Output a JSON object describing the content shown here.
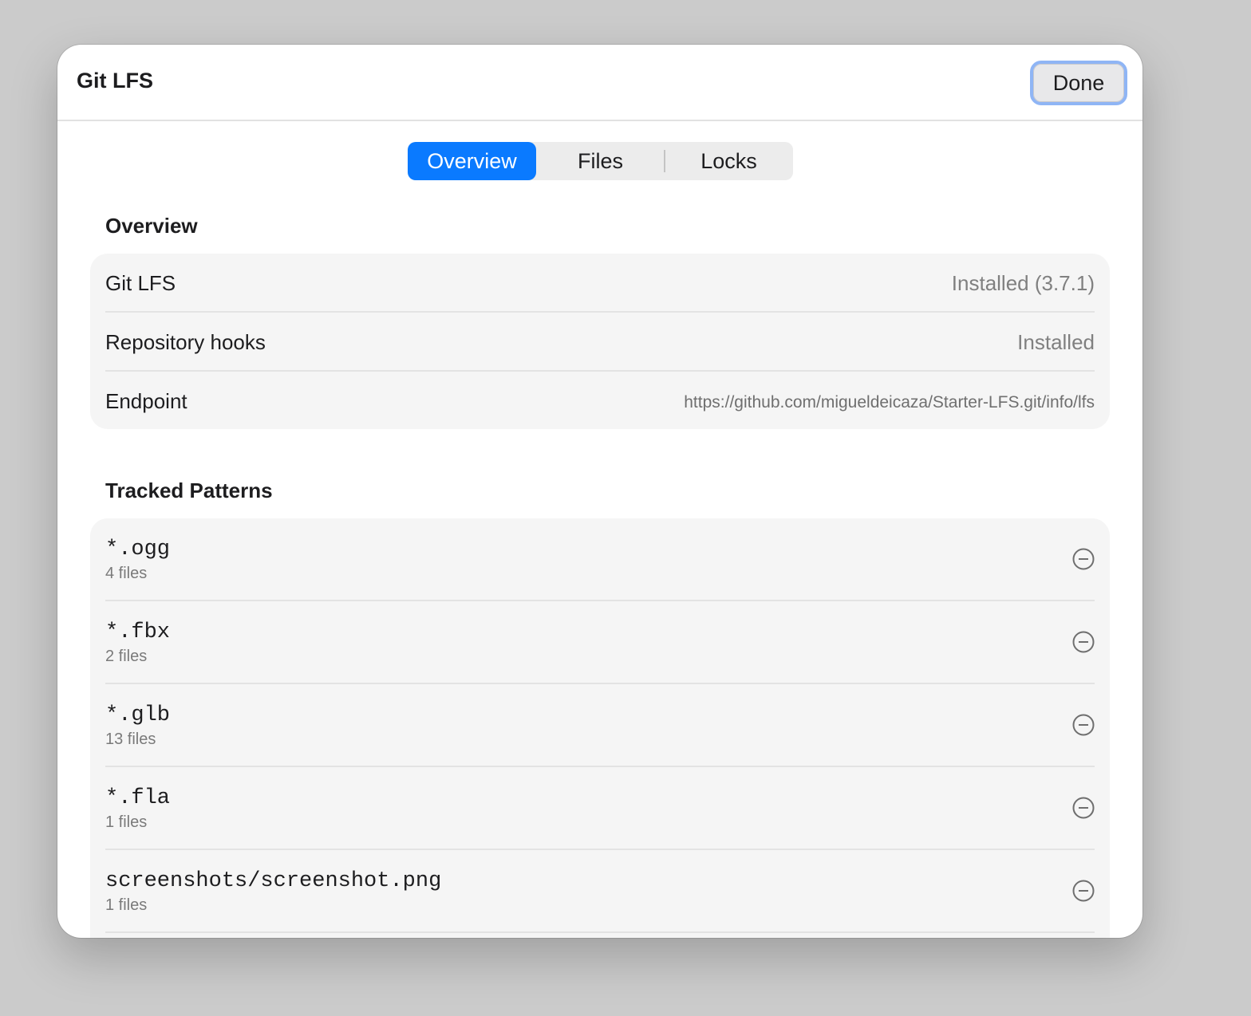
{
  "window": {
    "title": "Git LFS",
    "done_label": "Done"
  },
  "tabs": [
    {
      "label": "Overview",
      "selected": true
    },
    {
      "label": "Files",
      "selected": false
    },
    {
      "label": "Locks",
      "selected": false
    }
  ],
  "overview": {
    "heading": "Overview",
    "rows": [
      {
        "label": "Git LFS",
        "value": "Installed (3.7.1)"
      },
      {
        "label": "Repository hooks",
        "value": "Installed"
      },
      {
        "label": "Endpoint",
        "value": "https://github.com/migueldeicaza/Starter-LFS.git/info/lfs"
      }
    ]
  },
  "tracked": {
    "heading": "Tracked Patterns",
    "items": [
      {
        "pattern": "*.ogg",
        "count": "4 files"
      },
      {
        "pattern": "*.fbx",
        "count": "2 files"
      },
      {
        "pattern": "*.glb",
        "count": "13 files"
      },
      {
        "pattern": "*.fla",
        "count": "1 files"
      },
      {
        "pattern": "screenshots/screenshot.png",
        "count": "1 files"
      }
    ],
    "remove_icon": "minus-circle-icon"
  },
  "colors": {
    "accent": "#0a7aff",
    "focus_ring": "#8fb5f5",
    "group_background": "#f5f5f5",
    "secondary_text": "#808080"
  }
}
